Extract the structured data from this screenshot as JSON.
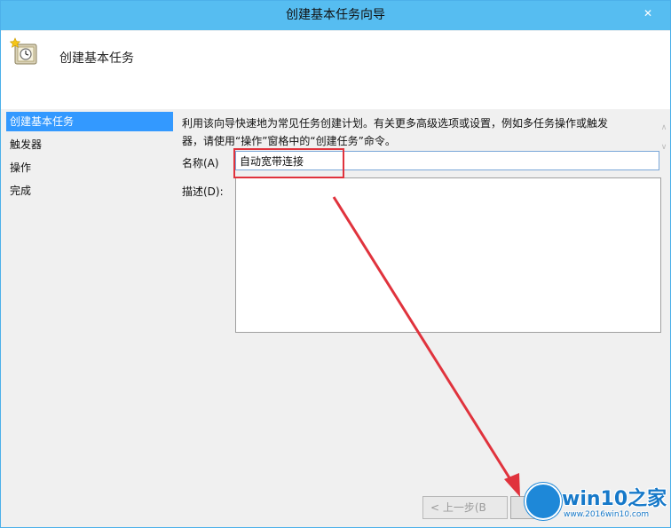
{
  "window": {
    "title": "创建基本任务向导",
    "close_glyph": "✕"
  },
  "header": {
    "title": "创建基本任务",
    "icon": "wizard-task-icon"
  },
  "nav": {
    "items": [
      {
        "label": "创建基本任务",
        "selected": true
      },
      {
        "label": "触发器",
        "selected": false
      },
      {
        "label": "操作",
        "selected": false
      },
      {
        "label": "完成",
        "selected": false
      }
    ]
  },
  "content": {
    "intro_line1": "利用该向导快速地为常见任务创建计划。有关更多高级选项或设置，例如多任务操作或触发",
    "intro_line2": "器，请使用“操作”窗格中的“创建任务”命令。",
    "name_label": "名称(A)",
    "name_value": "自动宽带连接",
    "desc_label": "描述(D):",
    "desc_value": ""
  },
  "buttons": {
    "prev_label": "< 上一步(B"
  },
  "watermark": {
    "brand": "win10之家",
    "url": "www.2016win10.com"
  },
  "colors": {
    "titlebar": "#56bdf1",
    "selection": "#3399ff",
    "highlight_red": "#e0333d"
  }
}
